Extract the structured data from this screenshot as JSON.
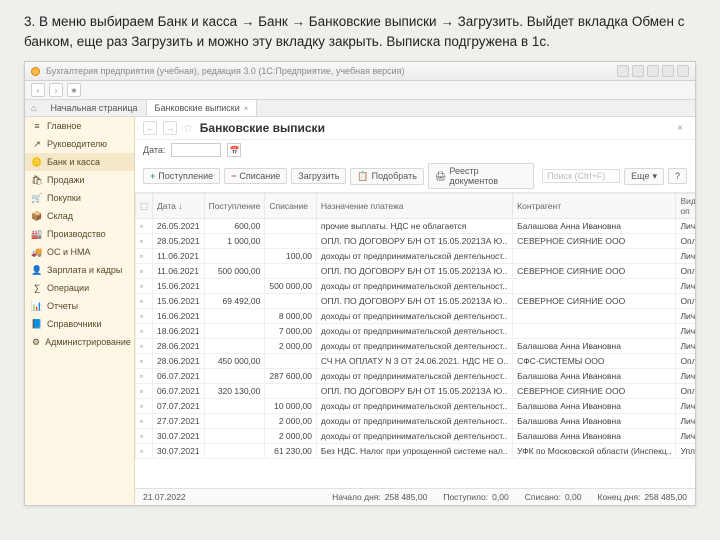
{
  "instruction": "3. В меню выбираем Банк и касса → Банк → Банковские выписки → Загрузить. Выйдет вкладка Обмен с банком, еще раз Загрузить и можно эту вкладку закрыть. Выписка подгружена в 1с.",
  "titlebar": {
    "title": "Бухгалтерия предприятия (учебная), редакция 3.0  (1С:Предприятие, учебная версия)"
  },
  "tabs": {
    "home": "Начальная страница",
    "active": "Банковские выписки"
  },
  "sidebar": {
    "items": [
      {
        "icon": "≡",
        "label": "Главное"
      },
      {
        "icon": "↗",
        "label": "Руководителю"
      },
      {
        "icon": "🪙",
        "label": "Банк и касса",
        "sel": true
      },
      {
        "icon": "🛍",
        "label": "Продажи"
      },
      {
        "icon": "🛒",
        "label": "Покупки"
      },
      {
        "icon": "📦",
        "label": "Склад"
      },
      {
        "icon": "🏭",
        "label": "Производство"
      },
      {
        "icon": "🚚",
        "label": "ОС и НМА"
      },
      {
        "icon": "👤",
        "label": "Зарплата и кадры"
      },
      {
        "icon": "∑",
        "label": "Операции"
      },
      {
        "icon": "📊",
        "label": "Отчеты"
      },
      {
        "icon": "📘",
        "label": "Справочники"
      },
      {
        "icon": "⚙",
        "label": "Администрирование"
      }
    ]
  },
  "page": {
    "title": "Банковские выписки",
    "date_label": "Дата:"
  },
  "actions": {
    "in": "Поступление",
    "out": "Списание",
    "load": "Загрузить",
    "pick": "Подобрать",
    "reg": "Реестр документов",
    "search_ph": "Поиск (Ctrl+F)",
    "more": "Еще"
  },
  "columns": {
    "date": "Дата",
    "in": "Поступление",
    "out": "Списание",
    "purpose": "Назначение платежа",
    "contr": "Контрагент",
    "type": "Вид оп"
  },
  "rows": [
    {
      "d": "26.05.2021",
      "i": "600,00",
      "o": "",
      "p": "прочие выплаты. НДС не облагается",
      "c": "Балашова Анна Ивановна",
      "t": "Личны"
    },
    {
      "d": "28.05.2021",
      "i": "1 000,00",
      "o": "",
      "p": "ОПЛ. ПО ДОГОВОРУ Б/Н ОТ 15.05.2021ЗА Ю..",
      "c": "СЕВЕРНОЕ СИЯНИЕ ООО",
      "t": "Оплат"
    },
    {
      "d": "11.06.2021",
      "i": "",
      "o": "100,00",
      "p": "доходы от предпринимательской деятельност..",
      "c": "",
      "t": "Личны"
    },
    {
      "d": "11.06.2021",
      "i": "500 000,00",
      "o": "",
      "p": "ОПЛ. ПО ДОГОВОРУ Б/Н ОТ 15.05.2021ЗА Ю..",
      "c": "СЕВЕРНОЕ СИЯНИЕ ООО",
      "t": "Оплат"
    },
    {
      "d": "15.06.2021",
      "i": "",
      "o": "500 000,00",
      "p": "доходы от предпринимательской деятельност..",
      "c": "",
      "t": "Личны"
    },
    {
      "d": "15.06.2021",
      "i": "69 492,00",
      "o": "",
      "p": "ОПЛ. ПО ДОГОВОРУ Б/Н ОТ 15.05.2021ЗА Ю..",
      "c": "СЕВЕРНОЕ СИЯНИЕ ООО",
      "t": "Оплат"
    },
    {
      "d": "16.06.2021",
      "i": "",
      "o": "8 000,00",
      "p": "доходы от предпринимательской деятельност..",
      "c": "",
      "t": "Личны"
    },
    {
      "d": "18.06.2021",
      "i": "",
      "o": "7 000,00",
      "p": "доходы от предпринимательской деятельност..",
      "c": "",
      "t": "Личны"
    },
    {
      "d": "28.06.2021",
      "i": "",
      "o": "2 000,00",
      "p": "доходы от предпринимательской деятельност..",
      "c": "Балашова Анна Ивановна",
      "t": "Личны"
    },
    {
      "d": "28.06.2021",
      "i": "450 000,00",
      "o": "",
      "p": "СЧ НА ОПЛАТУ N 3 ОТ 24.06.2021. НДС НЕ О..",
      "c": "СФС-СИСТЕМЫ ООО",
      "t": "Оплат"
    },
    {
      "d": "06.07.2021",
      "i": "",
      "o": "287 600,00",
      "p": "доходы от предпринимательской деятельност..",
      "c": "Балашова Анна Ивановна",
      "t": "Личны"
    },
    {
      "d": "06.07.2021",
      "i": "320 130,00",
      "o": "",
      "p": "ОПЛ. ПО ДОГОВОРУ Б/Н ОТ 15.05.2021ЗА Ю..",
      "c": "СЕВЕРНОЕ СИЯНИЕ ООО",
      "t": "Оплат"
    },
    {
      "d": "07.07.2021",
      "i": "",
      "o": "10 000,00",
      "p": "доходы от предпринимательской деятельност..",
      "c": "Балашова Анна Ивановна",
      "t": "Личны"
    },
    {
      "d": "27.07.2021",
      "i": "",
      "o": "2 000,00",
      "p": "доходы от предпринимательской деятельност..",
      "c": "Балашова Анна Ивановна",
      "t": "Личны"
    },
    {
      "d": "30.07.2021",
      "i": "",
      "o": "2 000,00",
      "p": "доходы от предпринимательской деятельност..",
      "c": "Балашова Анна Ивановна",
      "t": "Личны"
    },
    {
      "d": "30.07.2021",
      "i": "",
      "o": "61 230,00",
      "p": "Без НДС. Налог при упрощенной системе нал..",
      "c": "УФК по Московской области (Инспекц..",
      "t": "Уплат"
    }
  ],
  "status": {
    "date": "21.07.2022",
    "start_l": "Начало дня:",
    "start_v": "258 485,00",
    "in_l": "Поступило:",
    "in_v": "0,00",
    "out_l": "Списано:",
    "out_v": "0,00",
    "end_l": "Конец дня:",
    "end_v": "258 485,00"
  }
}
